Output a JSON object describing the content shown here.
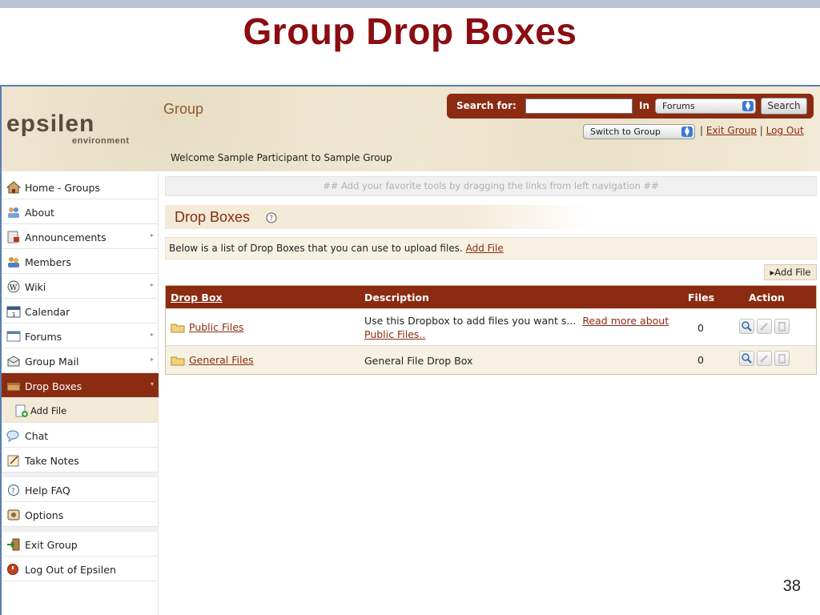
{
  "slide": {
    "title": "Group Drop Boxes",
    "number": "38"
  },
  "header": {
    "logo_main": "epsilen",
    "logo_sub": "environment",
    "section_title": "Group",
    "welcome": "Welcome Sample Participant to Sample Group",
    "search": {
      "label": "Search for:",
      "value": "",
      "in_label": "In",
      "scope_selected": "Forums",
      "button": "Search"
    },
    "switch_group": "Switch to Group",
    "links": {
      "separator": "|",
      "exit_group": "Exit Group",
      "log_out": "Log Out"
    }
  },
  "sidebar": {
    "items": [
      {
        "label": "Home - Groups",
        "icon": "home-icon"
      },
      {
        "label": "About",
        "icon": "people-icon"
      },
      {
        "label": "Announcements",
        "icon": "announcement-icon",
        "arrow": "▸"
      },
      {
        "label": "Members",
        "icon": "members-icon"
      },
      {
        "label": "Wiki",
        "icon": "wiki-icon",
        "arrow": "▸"
      },
      {
        "label": "Calendar",
        "icon": "calendar-icon"
      },
      {
        "label": "Forums",
        "icon": "forums-icon",
        "arrow": "▸"
      },
      {
        "label": "Group Mail",
        "icon": "mail-icon",
        "arrow": "▸"
      },
      {
        "label": "Drop Boxes",
        "icon": "dropbox-icon",
        "arrow": "▾",
        "active": true
      },
      {
        "label": "Add File",
        "icon": "add-file-icon",
        "sub": true
      },
      {
        "label": "Chat",
        "icon": "chat-icon"
      },
      {
        "label": "Take Notes",
        "icon": "notes-icon"
      },
      {
        "label": "Help FAQ",
        "icon": "help-icon"
      },
      {
        "label": "Options",
        "icon": "options-icon"
      },
      {
        "label": "Exit Group",
        "icon": "exit-icon"
      },
      {
        "label": "Log Out of Epsilen",
        "icon": "logout-icon"
      }
    ]
  },
  "main": {
    "favorites_hint": "## Add your favorite tools by dragging the links from left navigation ##",
    "section_title": "Drop Boxes",
    "intro_text": "Below is a list of Drop Boxes that you can use to upload files.",
    "intro_link": "Add File",
    "add_file_button": "Add File",
    "add_file_arrow": "▸",
    "table": {
      "columns": [
        "Drop Box",
        "Description",
        "Files",
        "Action"
      ],
      "rows": [
        {
          "name": "Public Files",
          "description": "Use this Dropbox to add files you want s...",
          "read_more": "Read more about Public Files..",
          "files": "0"
        },
        {
          "name": "General Files",
          "description": "General File Drop Box",
          "read_more": "",
          "files": "0"
        }
      ]
    }
  },
  "colors": {
    "title_red": "#8b0d12",
    "brand_brown": "#8b2b12",
    "parchment": "#f3ead7",
    "slide_rule_blue": "#5b7db3"
  }
}
